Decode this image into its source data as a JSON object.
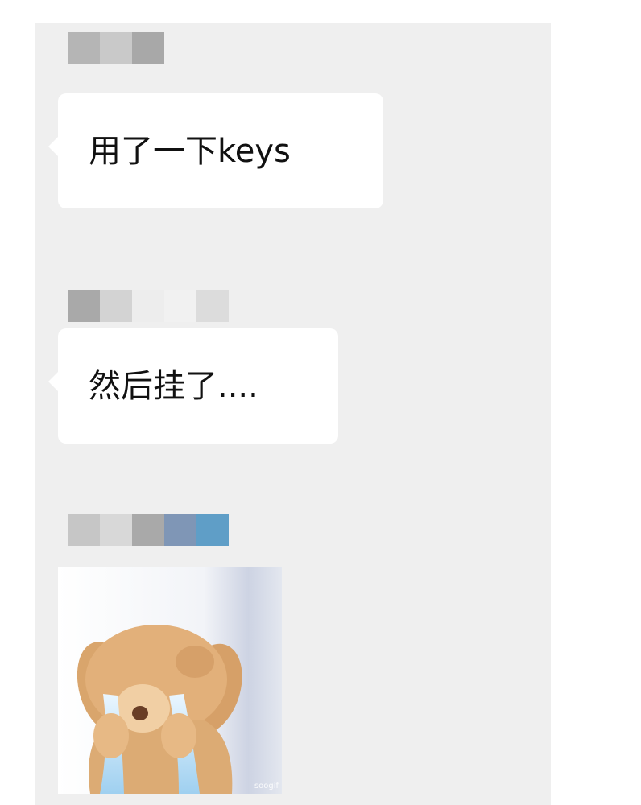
{
  "messages": [
    {
      "sender_pixels": [
        "#b5b5b5",
        "#c9c9c9",
        "#a8a8a8"
      ],
      "text": "用了一下keys"
    },
    {
      "sender_pixels": [
        "#a9a9a9",
        "#d3d3d3",
        "#ededed",
        "#f1f1f1",
        "#dcdcdc"
      ],
      "text": "然后挂了...."
    },
    {
      "sender_pixels": [
        "#c6c6c6",
        "#d8d8d8",
        "#a9a9a9",
        "#7f96b6",
        "#5f9ec7"
      ],
      "sticker": {
        "subject": "crying-puppy",
        "watermark": "soogif"
      }
    }
  ],
  "colors": {
    "panel_bg": "#efefef",
    "bubble_bg": "#ffffff",
    "text": "#111111"
  }
}
